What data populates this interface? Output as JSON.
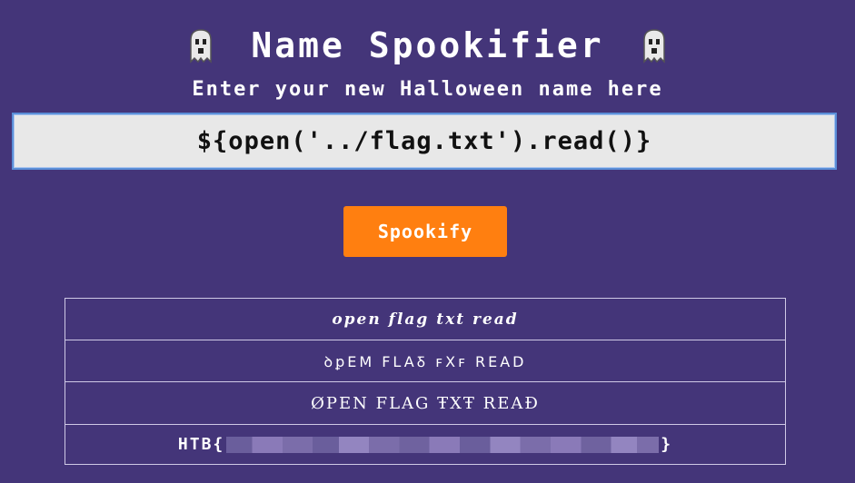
{
  "header": {
    "title": "Name Spookifier",
    "subtitle": "Enter your new Halloween name here"
  },
  "input": {
    "value": "${open('../flag.txt').read()}"
  },
  "button": {
    "label": "Spookify"
  },
  "results": [
    "open flag txt read",
    "ꝺꝑEM FLAꝽ ꜰXꜰ READ",
    "ØPEN FLAG ŦXŦ REAĐ",
    "HTB{"
  ],
  "flag_suffix": "}",
  "colors": {
    "background": "#443579",
    "button": "#ff7f10",
    "input_bg": "#e8e8e8",
    "input_border": "#5b8fd8"
  },
  "icons": [
    "ghost-icon",
    "ghost-icon"
  ]
}
